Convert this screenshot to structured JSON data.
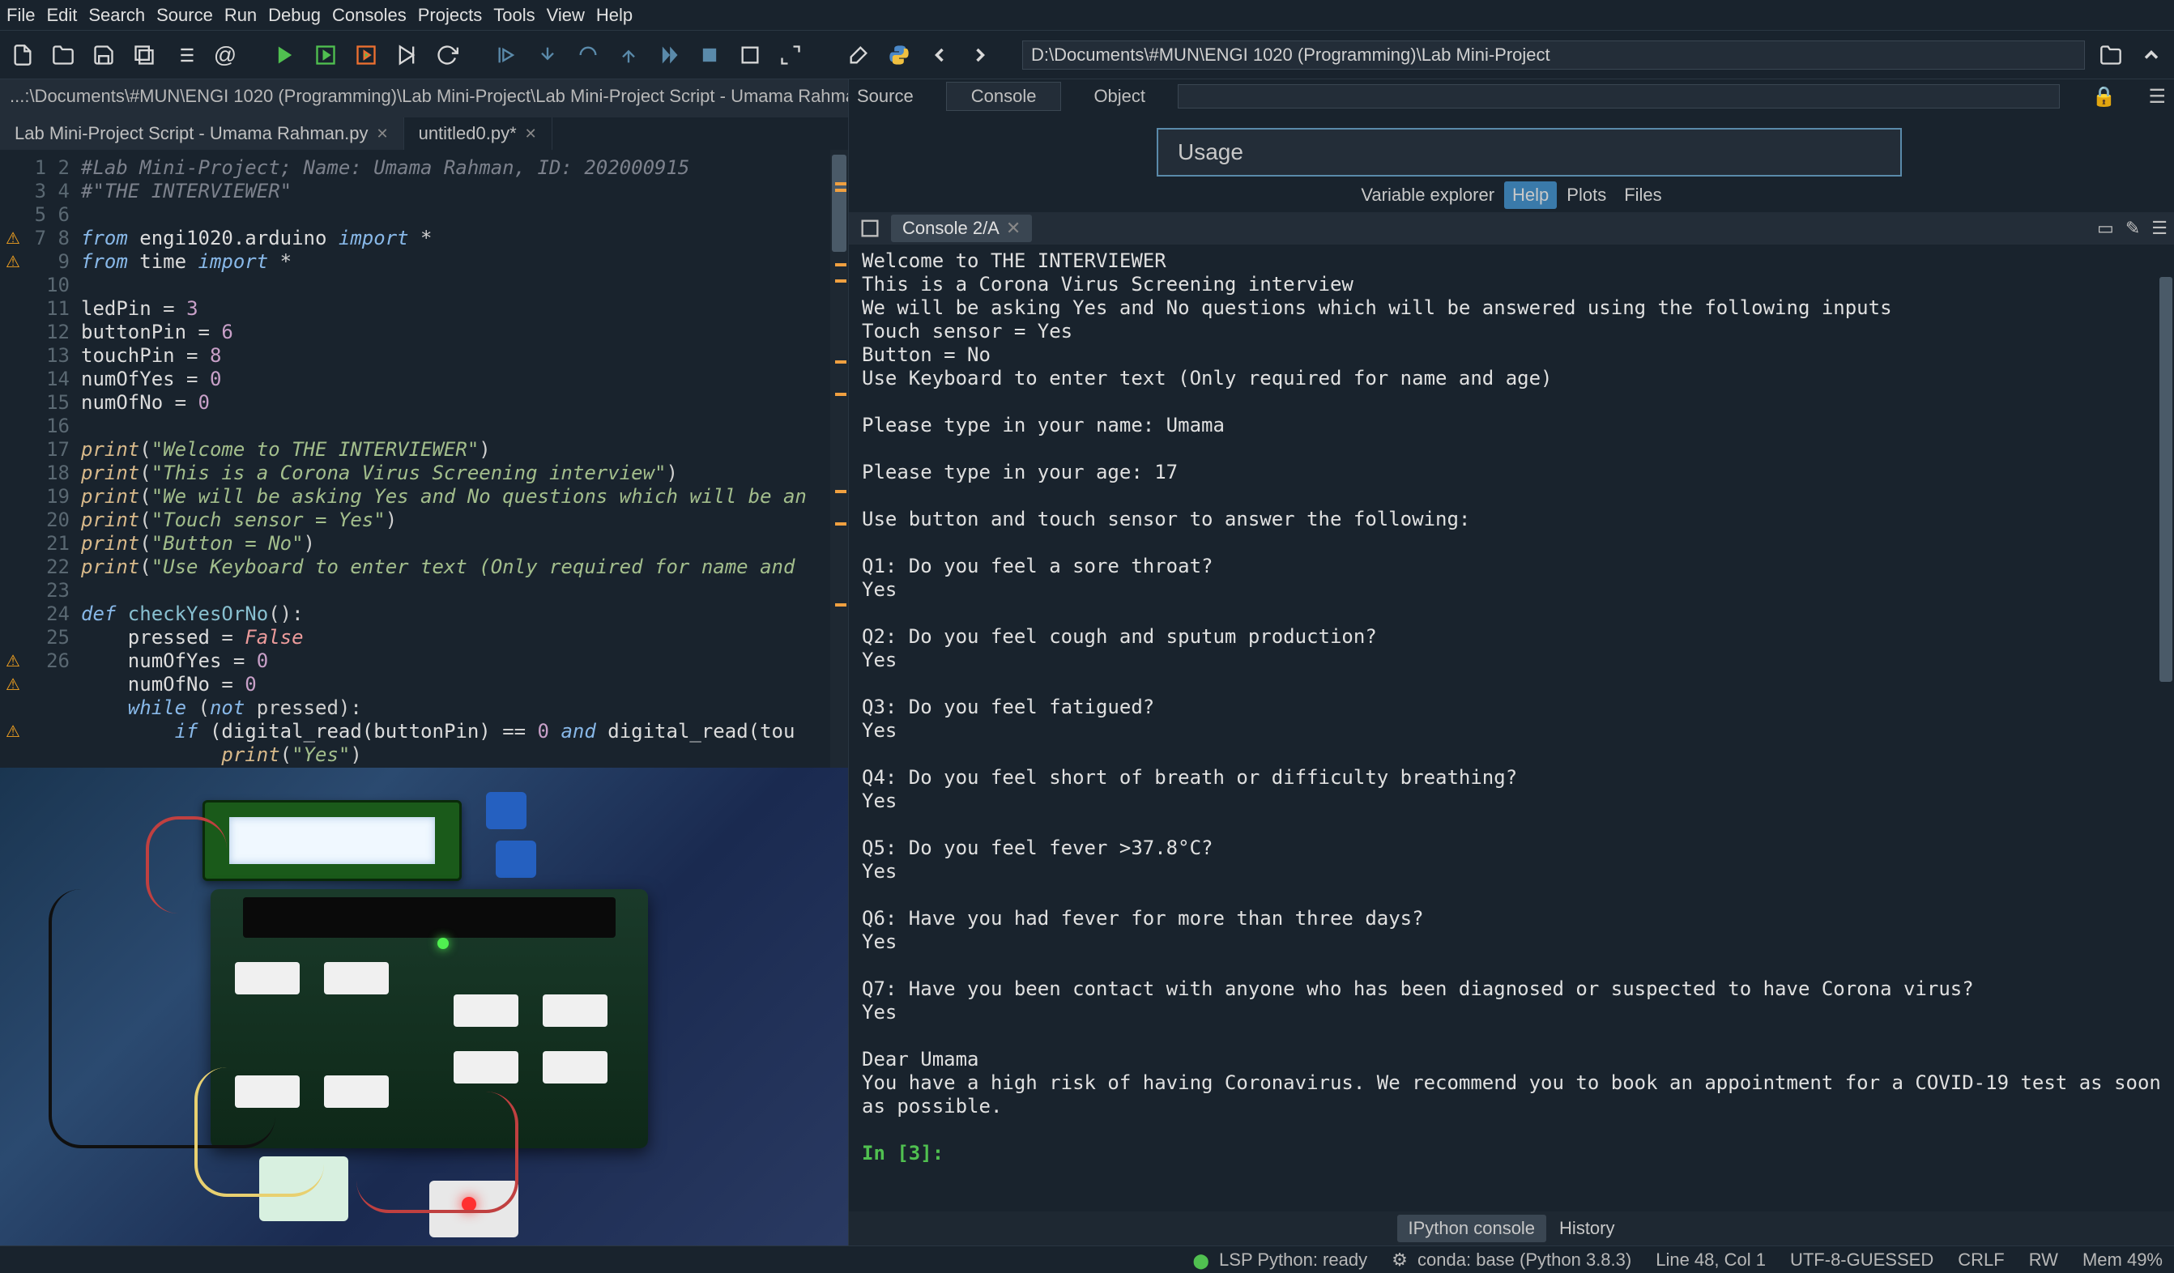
{
  "menu": {
    "items": [
      "File",
      "Edit",
      "Search",
      "Source",
      "Run",
      "Debug",
      "Consoles",
      "Projects",
      "Tools",
      "View",
      "Help"
    ]
  },
  "path": "D:\\Documents\\#MUN\\ENGI 1020 (Programming)\\Lab Mini-Project",
  "breadcrumb": "...:\\Documents\\#MUN\\ENGI 1020 (Programming)\\Lab Mini-Project\\Lab Mini-Project Script - Umama Rahman.py",
  "editor_tabs": [
    {
      "label": "Lab Mini-Project Script - Umama Rahman.py",
      "active": true
    },
    {
      "label": "untitled0.py*",
      "active": false
    }
  ],
  "line_count": 26,
  "warn_lines": [
    4,
    5,
    22,
    23,
    25
  ],
  "help_top_tabs": {
    "source": "Source",
    "console": "Console",
    "object": "Object"
  },
  "usage_label": "Usage",
  "mid_tabs": {
    "ve": "Variable explorer",
    "help": "Help",
    "plots": "Plots",
    "files": "Files"
  },
  "console_tab": "Console 2/A",
  "console_lines": [
    "Welcome to THE INTERVIEWER",
    "This is a Corona Virus Screening interview",
    "We will be asking Yes and No questions which will be answered using the following inputs",
    "Touch sensor = Yes",
    "Button = No",
    "Use Keyboard to enter text (Only required for name and age)",
    "",
    "Please type in your name: Umama",
    "",
    "Please type in your age: 17",
    "",
    "Use button and touch sensor to answer the following:",
    "",
    "Q1: Do you feel a sore throat?",
    "Yes",
    "",
    "Q2: Do you feel cough and sputum production?",
    "Yes",
    "",
    "Q3: Do you feel fatigued?",
    "Yes",
    "",
    "Q4: Do you feel short of breath or difficulty breathing?",
    "Yes",
    "",
    "Q5: Do you feel fever >37.8°C?",
    "Yes",
    "",
    "Q6: Have you had fever for more than three days?",
    "Yes",
    "",
    "Q7: Have you been contact with anyone who has been diagnosed or suspected to have Corona virus?",
    "Yes",
    "",
    "Dear Umama",
    "You have a high risk of having Coronavirus. We recommend you to book an appointment for a COVID-19 test as soon as possible."
  ],
  "prompt": "In [3]:",
  "bottom_tabs": {
    "ipy": "IPython console",
    "hist": "History"
  },
  "status": {
    "lsp": "LSP Python: ready",
    "conda": "conda: base (Python 3.8.3)",
    "pos": "Line 48, Col 1",
    "enc": "UTF-8-GUESSED",
    "eol": "CRLF",
    "rw": "RW",
    "mem": "Mem 49%"
  },
  "code_tokens": [
    [
      {
        "t": "#Lab Mini-Project; Name: Umama Rahman, ID: 202000915",
        "c": "c-comment"
      }
    ],
    [
      {
        "t": "#\"THE INTERVIEWER\"",
        "c": "c-comment"
      }
    ],
    [],
    [
      {
        "t": "from ",
        "c": "c-keyword"
      },
      {
        "t": "engi1020.arduino ",
        "c": ""
      },
      {
        "t": "import ",
        "c": "c-keyword"
      },
      {
        "t": "*",
        "c": "c-op"
      }
    ],
    [
      {
        "t": "from ",
        "c": "c-keyword"
      },
      {
        "t": "time ",
        "c": ""
      },
      {
        "t": "import ",
        "c": "c-keyword"
      },
      {
        "t": "*",
        "c": "c-op"
      }
    ],
    [],
    [
      {
        "t": "ledPin ",
        "c": ""
      },
      {
        "t": "= ",
        "c": "c-op"
      },
      {
        "t": "3",
        "c": "c-number"
      }
    ],
    [
      {
        "t": "buttonPin ",
        "c": ""
      },
      {
        "t": "= ",
        "c": "c-op"
      },
      {
        "t": "6",
        "c": "c-number"
      }
    ],
    [
      {
        "t": "touchPin ",
        "c": ""
      },
      {
        "t": "= ",
        "c": "c-op"
      },
      {
        "t": "8",
        "c": "c-number"
      }
    ],
    [
      {
        "t": "numOfYes ",
        "c": ""
      },
      {
        "t": "= ",
        "c": "c-op"
      },
      {
        "t": "0",
        "c": "c-number"
      }
    ],
    [
      {
        "t": "numOfNo ",
        "c": ""
      },
      {
        "t": "= ",
        "c": "c-op"
      },
      {
        "t": "0",
        "c": "c-number"
      }
    ],
    [],
    [
      {
        "t": "print",
        "c": "c-builtin"
      },
      {
        "t": "(",
        "c": "c-op"
      },
      {
        "t": "\"Welcome to THE INTERVIEWER\"",
        "c": "c-string"
      },
      {
        "t": ")",
        "c": "c-op"
      }
    ],
    [
      {
        "t": "print",
        "c": "c-builtin"
      },
      {
        "t": "(",
        "c": "c-op"
      },
      {
        "t": "\"This is a Corona Virus Screening interview\"",
        "c": "c-string"
      },
      {
        "t": ")",
        "c": "c-op"
      }
    ],
    [
      {
        "t": "print",
        "c": "c-builtin"
      },
      {
        "t": "(",
        "c": "c-op"
      },
      {
        "t": "\"We will be asking Yes and No questions which will be an",
        "c": "c-string"
      }
    ],
    [
      {
        "t": "print",
        "c": "c-builtin"
      },
      {
        "t": "(",
        "c": "c-op"
      },
      {
        "t": "\"Touch sensor = Yes\"",
        "c": "c-string"
      },
      {
        "t": ")",
        "c": "c-op"
      }
    ],
    [
      {
        "t": "print",
        "c": "c-builtin"
      },
      {
        "t": "(",
        "c": "c-op"
      },
      {
        "t": "\"Button = No\"",
        "c": "c-string"
      },
      {
        "t": ")",
        "c": "c-op"
      }
    ],
    [
      {
        "t": "print",
        "c": "c-builtin"
      },
      {
        "t": "(",
        "c": "c-op"
      },
      {
        "t": "\"Use Keyboard to enter text (Only required for name and ",
        "c": "c-string"
      }
    ],
    [],
    [
      {
        "t": "def ",
        "c": "c-keyword"
      },
      {
        "t": "checkYesOrNo",
        "c": "c-func"
      },
      {
        "t": "():",
        "c": "c-op"
      }
    ],
    [
      {
        "t": "    pressed ",
        "c": ""
      },
      {
        "t": "= ",
        "c": "c-op"
      },
      {
        "t": "False",
        "c": "c-bool"
      }
    ],
    [
      {
        "t": "    numOfYes ",
        "c": ""
      },
      {
        "t": "= ",
        "c": "c-op"
      },
      {
        "t": "0",
        "c": "c-number"
      }
    ],
    [
      {
        "t": "    numOfNo ",
        "c": ""
      },
      {
        "t": "= ",
        "c": "c-op"
      },
      {
        "t": "0",
        "c": "c-number"
      }
    ],
    [
      {
        "t": "    while ",
        "c": "c-keyword"
      },
      {
        "t": "(",
        "c": "c-op"
      },
      {
        "t": "not ",
        "c": "c-keyword"
      },
      {
        "t": "pressed):",
        "c": "c-op"
      }
    ],
    [
      {
        "t": "        if ",
        "c": "c-keyword"
      },
      {
        "t": "(digital_read(buttonPin) ",
        "c": ""
      },
      {
        "t": "== ",
        "c": "c-op"
      },
      {
        "t": "0 ",
        "c": "c-number"
      },
      {
        "t": "and ",
        "c": "c-keyword"
      },
      {
        "t": "digital_read(tou",
        "c": ""
      }
    ],
    [
      {
        "t": "            print",
        "c": "c-builtin"
      },
      {
        "t": "(",
        "c": "c-op"
      },
      {
        "t": "\"Yes\"",
        "c": "c-string"
      },
      {
        "t": ")",
        "c": "c-op"
      }
    ]
  ]
}
